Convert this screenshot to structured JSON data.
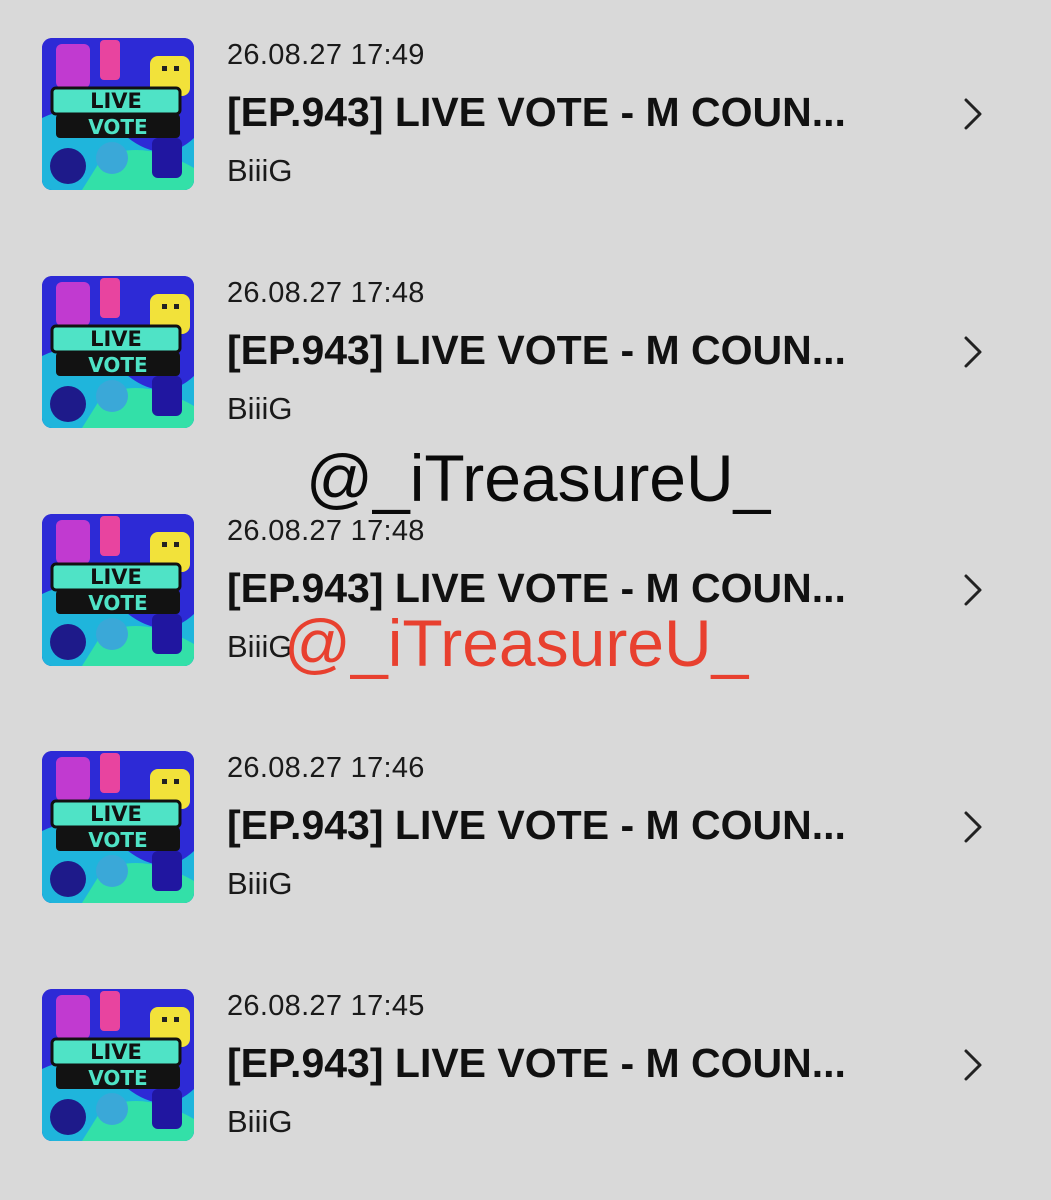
{
  "items": [
    {
      "date": "26.08.27 17:49",
      "title": "[EP.943] LIVE VOTE - M COUN...",
      "author": "BiiiG",
      "thumb_text_1": "LIVE",
      "thumb_text_2": "VOTE"
    },
    {
      "date": "26.08.27 17:48",
      "title": "[EP.943] LIVE VOTE - M COUN...",
      "author": "BiiiG",
      "thumb_text_1": "LIVE",
      "thumb_text_2": "VOTE"
    },
    {
      "date": "26.08.27 17:48",
      "title": "[EP.943] LIVE VOTE - M COUN...",
      "author": "BiiiG",
      "thumb_text_1": "LIVE",
      "thumb_text_2": "VOTE"
    },
    {
      "date": "26.08.27 17:46",
      "title": "[EP.943] LIVE VOTE - M COUN...",
      "author": "BiiiG",
      "thumb_text_1": "LIVE",
      "thumb_text_2": "VOTE"
    },
    {
      "date": "26.08.27 17:45",
      "title": "[EP.943] LIVE VOTE - M COUN...",
      "author": "BiiiG",
      "thumb_text_1": "LIVE",
      "thumb_text_2": "VOTE"
    }
  ],
  "watermarks": {
    "primary": "@_iTreasureU_",
    "secondary": "@_iTreasureU_"
  },
  "icons": {
    "row_arrow": "chevron-right-icon"
  },
  "colors": {
    "background": "#d9d9d9",
    "watermark_red": "#e8402f",
    "thumb_banner": "#4fe3c6"
  }
}
